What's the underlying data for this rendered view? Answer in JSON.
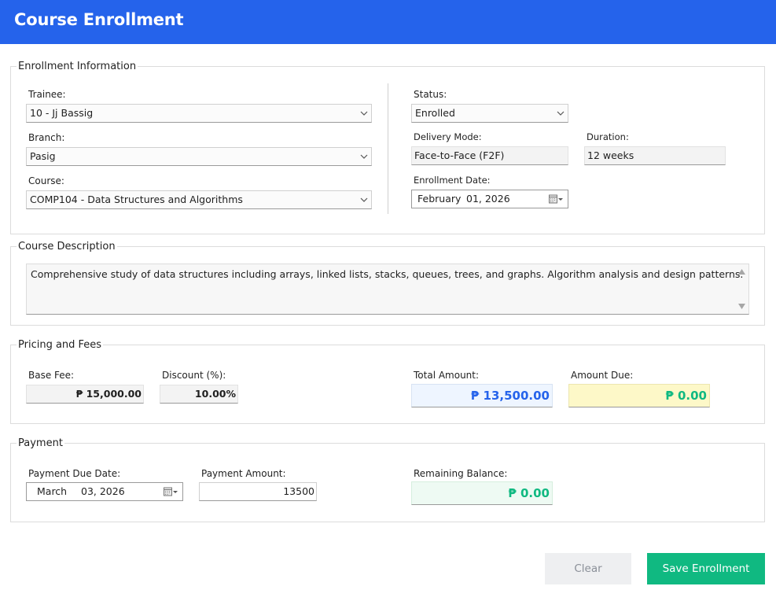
{
  "header": {
    "title": "Course Enrollment"
  },
  "enrollment": {
    "legend": "Enrollment Information",
    "trainee_label": "Trainee:",
    "trainee_value": "10 - Jj Bassig",
    "branch_label": "Branch:",
    "branch_value": "Pasig",
    "course_label": "Course:",
    "course_value": "COMP104 - Data Structures and Algorithms",
    "status_label": "Status:",
    "status_value": "Enrolled",
    "delivery_label": "Delivery Mode:",
    "delivery_value": "Face-to-Face (F2F)",
    "duration_label": "Duration:",
    "duration_value": "12 weeks",
    "date_label": "Enrollment Date:",
    "date_month": "February",
    "date_day_year": "01, 2026"
  },
  "description": {
    "legend": "Course Description",
    "text": "Comprehensive study of data structures including arrays, linked lists, stacks, queues, trees, and graphs. Algorithm analysis and design patterns."
  },
  "pricing": {
    "legend": "Pricing and Fees",
    "base_fee_label": "Base Fee:",
    "base_fee_value": "₱ 15,000.00",
    "discount_label": "Discount (%):",
    "discount_value": "10.00%",
    "total_label": "Total Amount:",
    "total_value": "₱ 13,500.00",
    "due_label": "Amount Due:",
    "due_value": "₱ 0.00"
  },
  "payment": {
    "legend": "Payment",
    "due_date_label": "Payment Due Date:",
    "due_date_month": "March",
    "due_date_day_year": "03, 2026",
    "amount_label": "Payment Amount:",
    "amount_value": "13500",
    "balance_label": "Remaining Balance:",
    "balance_value": "₱ 0.00"
  },
  "actions": {
    "clear_label": "Clear",
    "save_label": "Save Enrollment"
  },
  "colors": {
    "header": "#2563eb",
    "total_text": "#2563eb",
    "total_bg": "#eef5ff",
    "due_text": "#10b981",
    "due_bg": "#fdf8c8",
    "balance_text": "#10b981",
    "balance_bg": "#eefaf3",
    "save_bg": "#10b981",
    "clear_bg": "#eeeff1"
  },
  "icons": {
    "dropdown": "chevron-down-icon",
    "calendar": "calendar-icon",
    "scroll_up": "arrow-up-icon",
    "scroll_down": "arrow-down-icon"
  }
}
